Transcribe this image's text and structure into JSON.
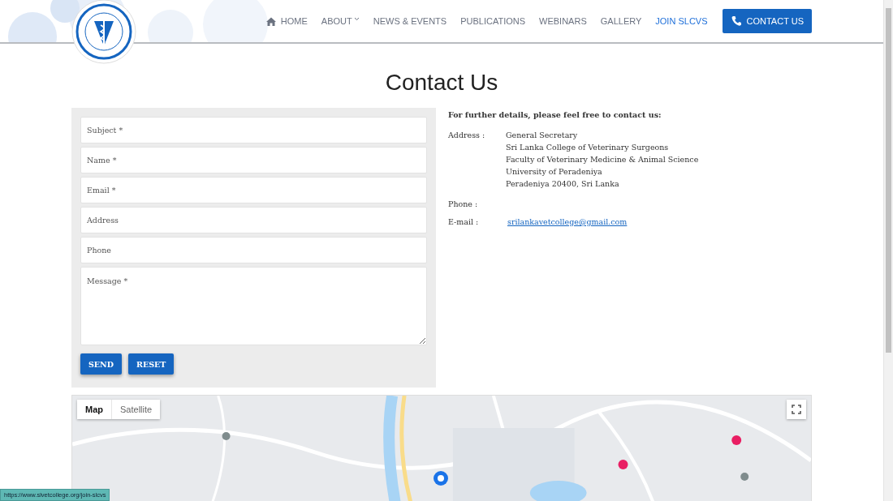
{
  "header": {
    "nav": [
      {
        "label": "HOME",
        "kind": "home",
        "hovered": false
      },
      {
        "label": "ABOUT",
        "kind": "dropdown",
        "hovered": false
      },
      {
        "label": "NEWS & EVENTS",
        "kind": "plain",
        "hovered": false
      },
      {
        "label": "PUBLICATIONS",
        "kind": "plain",
        "hovered": false
      },
      {
        "label": "WEBINARS",
        "kind": "plain",
        "hovered": false
      },
      {
        "label": "GALLERY",
        "kind": "plain",
        "hovered": false
      },
      {
        "label": "JOIN SLCVS",
        "kind": "plain",
        "hovered": true
      },
      {
        "label": "CONTACT US",
        "kind": "button",
        "hovered": false
      }
    ]
  },
  "title": "Contact Us",
  "form": {
    "fields": [
      {
        "placeholder": "Subject *",
        "kind": "line"
      },
      {
        "placeholder": "Name *",
        "kind": "line"
      },
      {
        "placeholder": "Email *",
        "kind": "line"
      },
      {
        "placeholder": "Address",
        "kind": "line"
      },
      {
        "placeholder": "Phone",
        "kind": "line"
      },
      {
        "placeholder": "Message *",
        "kind": "area"
      }
    ],
    "buttons": [
      "SEND",
      "RESET"
    ]
  },
  "contact": {
    "intro": "For further details, please feel free to contact us:",
    "rows": [
      {
        "label": "Address :",
        "lines": [
          "General Secretary",
          "Sri Lanka College of Veterinary Surgeons",
          "Faculty of Veterinary Medicine & Animal Science",
          "University of Peradeniya",
          "Peradeniya 20400, Sri Lanka"
        ],
        "kind": "text"
      },
      {
        "label": "Phone :",
        "kind": "text"
      },
      {
        "label": "E-mail :",
        "lines": [
          "srilankavetcollege@gmail.com"
        ],
        "kind": "link"
      }
    ]
  },
  "map": {
    "kind": "picture",
    "types": [
      {
        "label": "Map",
        "selected": true
      },
      {
        "label": "Satellite",
        "selected": false
      }
    ]
  },
  "status_bar": "https://www.slvetcollege.org/join-slcvs"
}
